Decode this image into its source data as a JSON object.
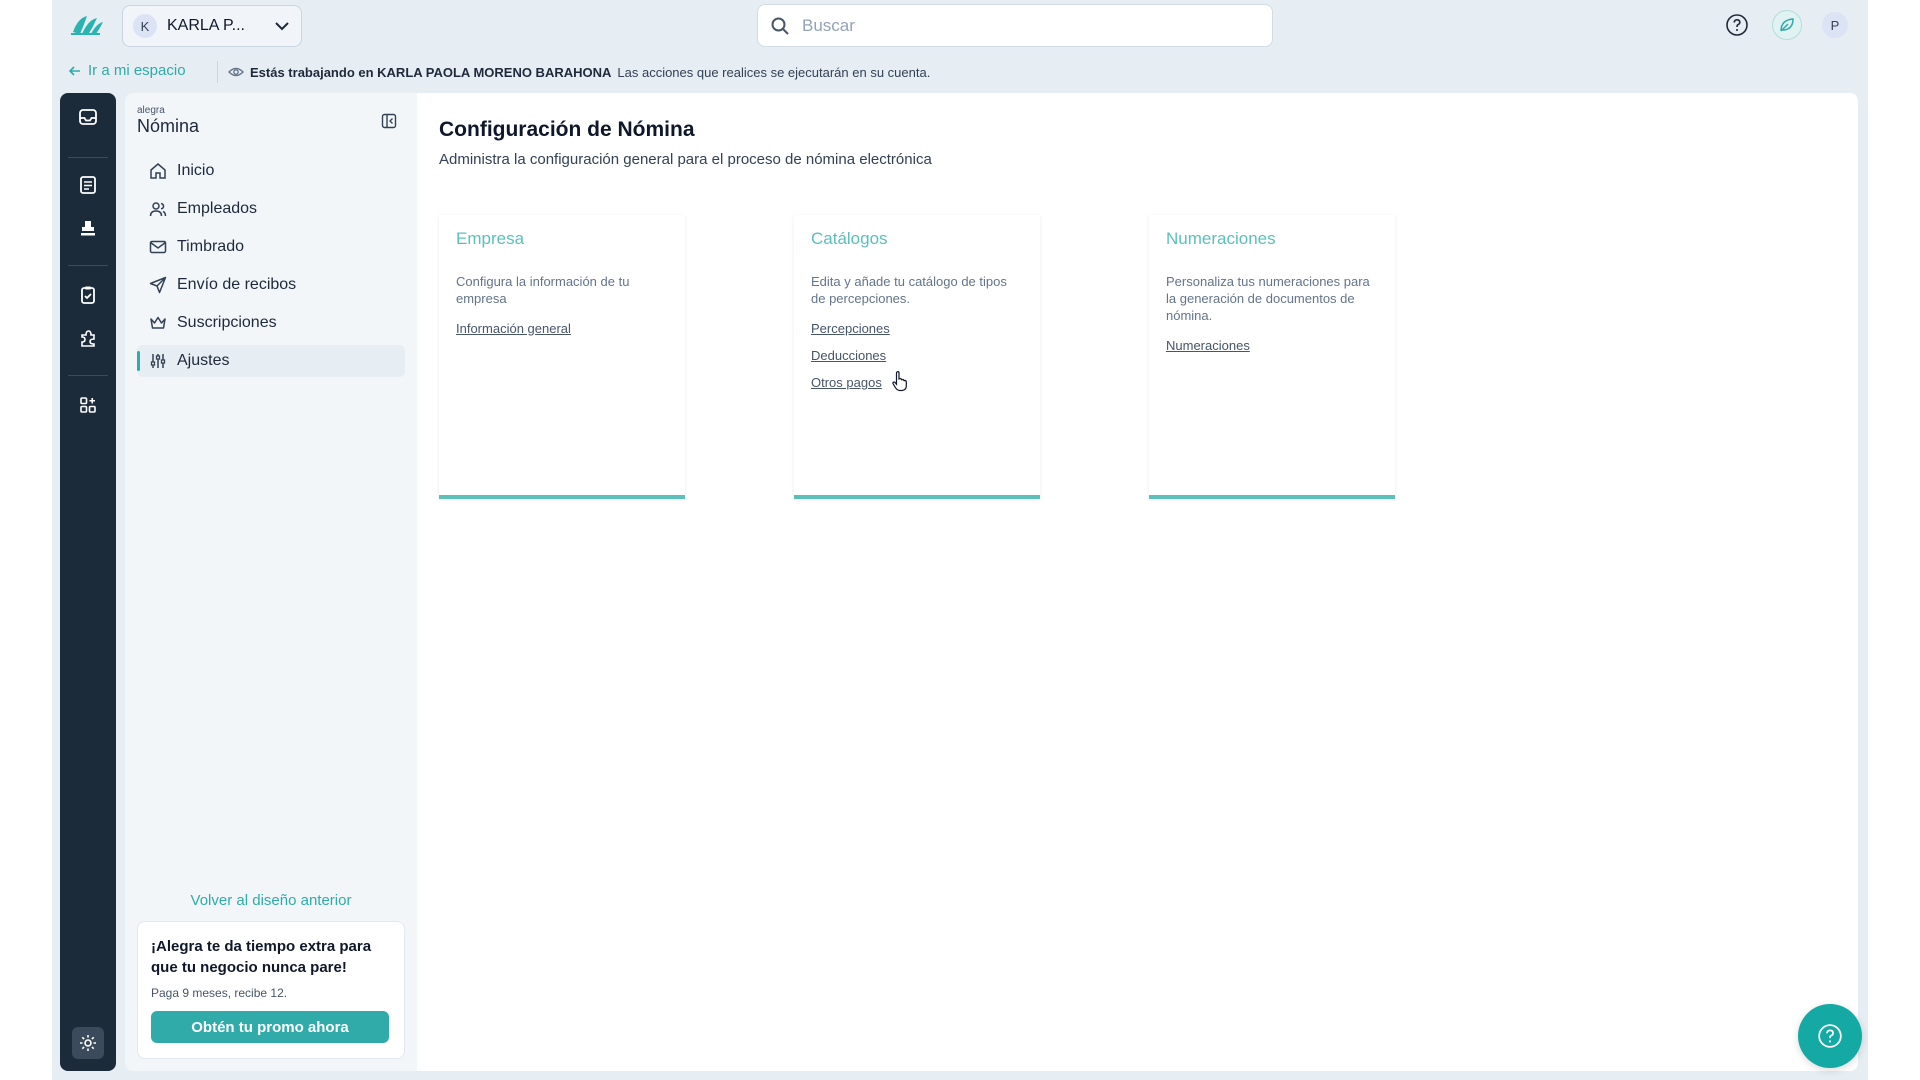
{
  "topbar": {
    "account": {
      "initial": "K",
      "name": "KARLA P..."
    },
    "search": {
      "placeholder": "Buscar"
    },
    "user_initial": "P"
  },
  "banner": {
    "back_label": "Ir a mi espacio",
    "message_bold": "Estás trabajando en KARLA PAOLA MORENO BARAHONA",
    "message_rest": "Las acciones que realices se ejecutarán en su cuenta."
  },
  "sidebar": {
    "brand_small": "alegra",
    "brand_big": "Nómina",
    "items": [
      {
        "label": "Inicio",
        "icon": "home-icon"
      },
      {
        "label": "Empleados",
        "icon": "users-icon"
      },
      {
        "label": "Timbrado",
        "icon": "mail-icon"
      },
      {
        "label": "Envío de recibos",
        "icon": "send-icon"
      },
      {
        "label": "Suscripciones",
        "icon": "crown-icon"
      },
      {
        "label": "Ajustes",
        "icon": "sliders-icon",
        "active": true
      }
    ],
    "back_design": "Volver al diseño anterior",
    "promo": {
      "title": "¡Alegra te da tiempo extra para que tu negocio nunca pare!",
      "subtitle": "Paga 9 meses, recibe 12.",
      "button": "Obtén tu promo ahora"
    }
  },
  "main": {
    "title": "Configuración de Nómina",
    "subtitle": "Administra la configuración general para el proceso de nómina electrónica",
    "cards": [
      {
        "title": "Empresa",
        "description": "Configura la información de tu empresa",
        "links": [
          "Información general"
        ]
      },
      {
        "title": "Catálogos",
        "description": "Edita y añade tu catálogo de tipos de percepciones.",
        "links": [
          "Percepciones",
          "Deducciones",
          "Otros pagos"
        ]
      },
      {
        "title": "Numeraciones",
        "description": "Personaliza tus numeraciones para la generación de documentos de nómina.",
        "links": [
          "Numeraciones"
        ]
      }
    ]
  },
  "colors": {
    "accent": "#30aba9",
    "rail": "#1c2b3a",
    "card_title": "#5dbfba"
  }
}
